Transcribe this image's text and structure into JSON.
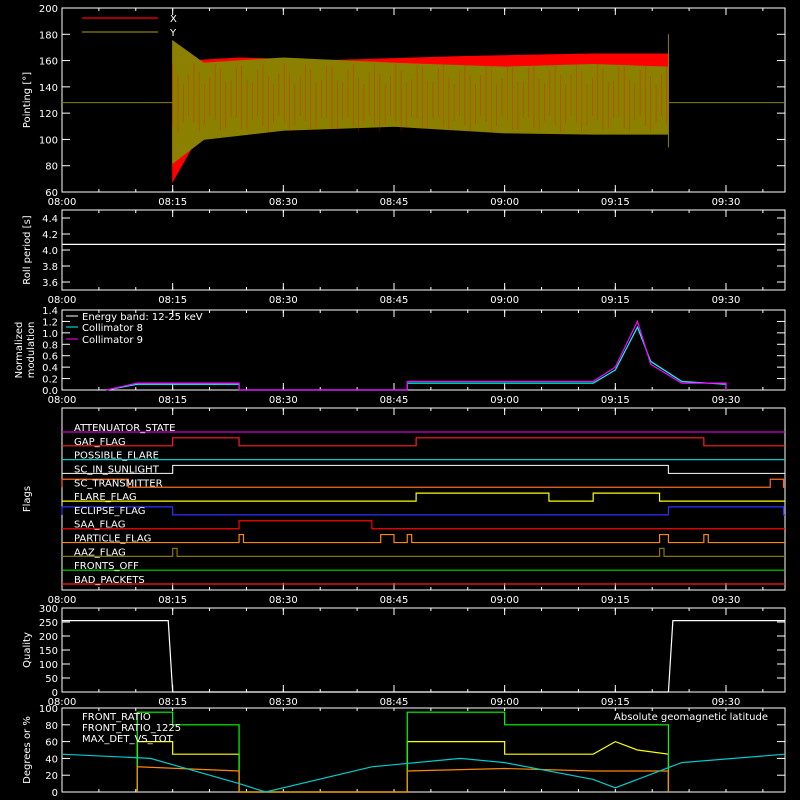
{
  "chart_data": [
    {
      "type": "line",
      "panel": "pointing",
      "ylabel": "Pointing [°]",
      "xlim": [
        "08:00",
        "09:38"
      ],
      "ylim": [
        60,
        200
      ],
      "yticks": [
        60,
        80,
        100,
        120,
        140,
        160,
        180,
        200
      ],
      "xticks": [
        "08:00",
        "08:15",
        "08:30",
        "08:45",
        "09:00",
        "09:15",
        "09:30"
      ],
      "legend": "top-left",
      "series": [
        {
          "name": "X",
          "color": "#ff0000",
          "upper": [
            [
              8.25,
              128
            ],
            [
              8.25,
              170
            ],
            [
              8.3,
              160
            ],
            [
              8.4,
              162
            ],
            [
              8.6,
              160
            ],
            [
              8.9,
              163
            ],
            [
              9.2,
              165
            ],
            [
              9.37,
              165
            ],
            [
              9.37,
              128
            ]
          ],
          "lower": [
            [
              8.25,
              128
            ],
            [
              8.25,
              68
            ],
            [
              8.32,
              110
            ],
            [
              8.5,
              116
            ],
            [
              8.7,
              118
            ],
            [
              9.0,
              114
            ],
            [
              9.2,
              114
            ],
            [
              9.37,
              112
            ],
            [
              9.37,
              128
            ]
          ]
        },
        {
          "name": "Y",
          "color": "#8b8000",
          "baseline": 128,
          "upper": [
            [
              8.25,
              128
            ],
            [
              8.25,
              175
            ],
            [
              8.32,
              158
            ],
            [
              8.5,
              162
            ],
            [
              8.75,
              158
            ],
            [
              9.0,
              155
            ],
            [
              9.2,
              157
            ],
            [
              9.37,
              155
            ],
            [
              9.37,
              180
            ]
          ],
          "lower": [
            [
              8.25,
              128
            ],
            [
              8.25,
              82
            ],
            [
              8.32,
              100
            ],
            [
              8.5,
              107
            ],
            [
              8.75,
              110
            ],
            [
              9.0,
              105
            ],
            [
              9.2,
              104
            ],
            [
              9.37,
              104
            ],
            [
              9.37,
              94
            ]
          ]
        }
      ]
    },
    {
      "type": "line",
      "panel": "roll",
      "ylabel": "Roll period [s]",
      "xlim": [
        "08:00",
        "09:38"
      ],
      "ylim": [
        3.5,
        4.5
      ],
      "yticks": [
        3.6,
        3.8,
        4.0,
        4.2,
        4.4
      ],
      "xticks": [
        "08:00",
        "08:15",
        "08:30",
        "08:45",
        "09:00",
        "09:15",
        "09:30"
      ],
      "series": [
        {
          "name": "",
          "color": "#ffffff",
          "points": [
            [
              8.0,
              4.07
            ],
            [
              9.633,
              4.07
            ]
          ]
        }
      ]
    },
    {
      "type": "line",
      "panel": "modulation",
      "ylabel": "Normalized modulation",
      "xlim": [
        "08:00",
        "09:38"
      ],
      "ylim": [
        0,
        1.4
      ],
      "yticks": [
        0.0,
        0.2,
        0.4,
        0.6,
        0.8,
        1.0,
        1.2,
        1.4
      ],
      "xticks": [
        "08:00",
        "08:15",
        "08:30",
        "08:45",
        "09:00",
        "09:15",
        "09:30"
      ],
      "legend": "top-left",
      "annotation": "Energy band: 12-25 keV",
      "series": [
        {
          "name": "Collimator 8",
          "color": "#00ffff",
          "points": [
            [
              8.1,
              0
            ],
            [
              8.17,
              0.1
            ],
            [
              8.4,
              0.1
            ],
            [
              8.4,
              0
            ],
            [
              8.78,
              0
            ],
            [
              8.78,
              0.12
            ],
            [
              9.2,
              0.12
            ],
            [
              9.25,
              0.35
            ],
            [
              9.3,
              1.1
            ],
            [
              9.33,
              0.5
            ],
            [
              9.4,
              0.15
            ],
            [
              9.5,
              0.1
            ],
            [
              9.5,
              0
            ]
          ]
        },
        {
          "name": "Collimator 9",
          "color": "#ff00ff",
          "points": [
            [
              8.1,
              0
            ],
            [
              8.17,
              0.12
            ],
            [
              8.4,
              0.12
            ],
            [
              8.4,
              0
            ],
            [
              8.78,
              0
            ],
            [
              8.78,
              0.15
            ],
            [
              9.2,
              0.15
            ],
            [
              9.25,
              0.4
            ],
            [
              9.3,
              1.2
            ],
            [
              9.33,
              0.45
            ],
            [
              9.4,
              0.12
            ],
            [
              9.5,
              0.12
            ],
            [
              9.5,
              0
            ]
          ]
        }
      ]
    },
    {
      "type": "flags",
      "panel": "flags",
      "ylabel": "Flags",
      "xlim": [
        "08:00",
        "09:38"
      ],
      "xticks": [
        "08:00",
        "08:15",
        "08:30",
        "08:45",
        "09:00",
        "09:15",
        "09:30"
      ],
      "rows": [
        {
          "name": "ATTENUATOR_STATE",
          "color": "#cc00cc",
          "on": []
        },
        {
          "name": "GAP_FLAG",
          "color": "#ff2020",
          "on": [
            [
              8.25,
              8.4
            ],
            [
              8.8,
              9.45
            ]
          ]
        },
        {
          "name": "POSSIBLE_FLARE",
          "color": "#00cccc",
          "on": []
        },
        {
          "name": "SC_IN_SUNLIGHT",
          "color": "#e0e0e0",
          "on": [
            [
              8.25,
              9.37
            ]
          ]
        },
        {
          "name": "SC_TRANSMITTER",
          "color": "#ff6a1a",
          "on": [
            [
              8.0,
              8.15
            ],
            [
              9.6,
              9.63
            ]
          ]
        },
        {
          "name": "FLARE_FLAG",
          "color": "#ffff00",
          "on": [
            [
              8.8,
              9.1
            ],
            [
              9.2,
              9.35
            ]
          ]
        },
        {
          "name": "ECLIPSE_FLAG",
          "color": "#3030ff",
          "on": [
            [
              8.0,
              8.25
            ],
            [
              9.37,
              9.63
            ]
          ]
        },
        {
          "name": "SAA_FLAG",
          "color": "#ff0000",
          "on": [
            [
              8.4,
              8.7
            ]
          ]
        },
        {
          "name": "PARTICLE_FLAG",
          "color": "#ff8800",
          "on": [
            [
              8.4,
              8.41
            ],
            [
              8.72,
              8.75
            ],
            [
              8.78,
              8.79
            ],
            [
              9.35,
              9.37
            ],
            [
              9.45,
              9.46
            ]
          ]
        },
        {
          "name": "AAZ_FLAG",
          "color": "#8b7500",
          "on": [
            [
              8.25,
              8.26
            ],
            [
              9.35,
              9.36
            ]
          ]
        },
        {
          "name": "FRONTS_OFF",
          "color": "#00dd00",
          "on": []
        },
        {
          "name": "BAD_PACKETS",
          "color": "#ff1a1a",
          "on": []
        }
      ]
    },
    {
      "type": "line",
      "panel": "quality",
      "ylabel": "Quality",
      "xlim": [
        "08:00",
        "09:38"
      ],
      "ylim": [
        0,
        300
      ],
      "yticks": [
        0,
        50,
        100,
        150,
        200,
        250,
        300
      ],
      "xticks": [
        "08:00",
        "08:15",
        "08:30",
        "08:45",
        "09:00",
        "09:15",
        "09:30"
      ],
      "series": [
        {
          "name": "",
          "color": "#ffffff",
          "points": [
            [
              8.0,
              255
            ],
            [
              8.24,
              255
            ],
            [
              8.25,
              0
            ],
            [
              9.37,
              0
            ],
            [
              9.38,
              255
            ],
            [
              9.633,
              255
            ]
          ]
        }
      ]
    },
    {
      "type": "line",
      "panel": "ratios",
      "ylabel": "Degrees or %",
      "xlim": [
        "08:00",
        "09:38"
      ],
      "ylim": [
        0,
        100
      ],
      "yticks": [
        0,
        20,
        40,
        60,
        80,
        100
      ],
      "legend": "top-left",
      "series": [
        {
          "name": "FRONT_RATIO",
          "color": "#ffff00",
          "points": [
            [
              8.17,
              0
            ],
            [
              8.17,
              60
            ],
            [
              8.25,
              60
            ],
            [
              8.25,
              45
            ],
            [
              8.4,
              45
            ],
            [
              8.4,
              0
            ],
            [
              8.78,
              0
            ],
            [
              8.78,
              60
            ],
            [
              9.0,
              60
            ],
            [
              9.0,
              45
            ],
            [
              9.2,
              45
            ],
            [
              9.25,
              60
            ],
            [
              9.3,
              50
            ],
            [
              9.37,
              45
            ],
            [
              9.37,
              0
            ]
          ]
        },
        {
          "name": "FRONT_RATIO_1225",
          "color": "#00ff00",
          "points": [
            [
              8.17,
              0
            ],
            [
              8.17,
              95
            ],
            [
              8.25,
              95
            ],
            [
              8.25,
              80
            ],
            [
              8.4,
              80
            ],
            [
              8.4,
              0
            ],
            [
              8.78,
              0
            ],
            [
              8.78,
              95
            ],
            [
              9.0,
              95
            ],
            [
              9.0,
              80
            ],
            [
              9.37,
              80
            ],
            [
              9.37,
              0
            ]
          ]
        },
        {
          "name": "MAX_DET_VS_TOT",
          "color": "#ff8800",
          "points": [
            [
              8.17,
              0
            ],
            [
              8.17,
              30
            ],
            [
              8.4,
              25
            ],
            [
              8.4,
              0
            ],
            [
              8.78,
              0
            ],
            [
              8.78,
              25
            ],
            [
              9.0,
              28
            ],
            [
              9.2,
              25
            ],
            [
              9.37,
              25
            ],
            [
              9.37,
              0
            ]
          ]
        },
        {
          "name": "Absolute geomagnetic latitude",
          "color": "#00cccc",
          "points": [
            [
              8.0,
              45
            ],
            [
              8.2,
              40
            ],
            [
              8.4,
              10
            ],
            [
              8.46,
              0
            ],
            [
              8.7,
              30
            ],
            [
              8.9,
              40
            ],
            [
              9.0,
              35
            ],
            [
              9.2,
              15
            ],
            [
              9.25,
              5
            ],
            [
              9.4,
              35
            ],
            [
              9.633,
              45
            ]
          ]
        }
      ]
    }
  ]
}
